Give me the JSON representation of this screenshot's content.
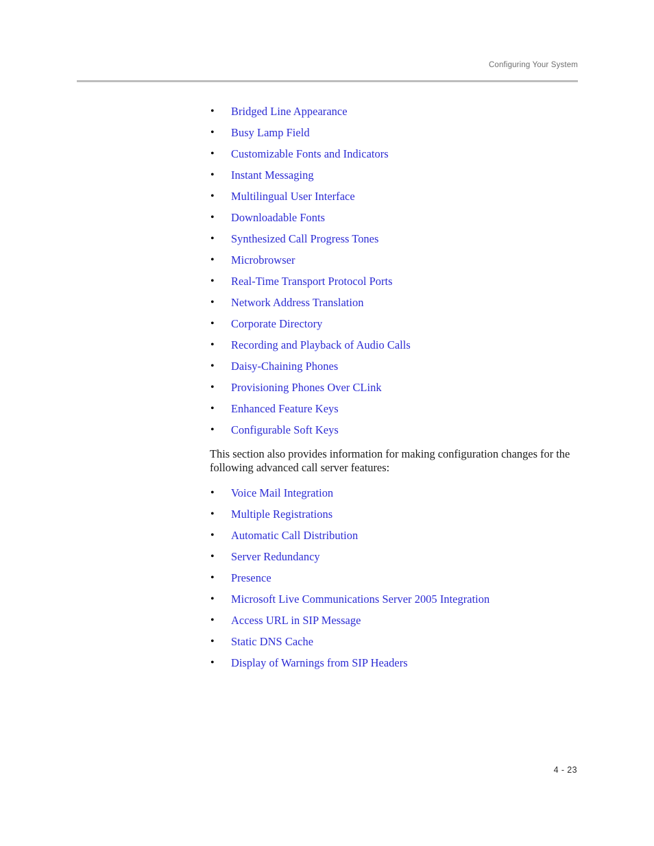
{
  "header": {
    "title": "Configuring Your System"
  },
  "colors": {
    "link": "#2b2bd4",
    "header_text": "#6e6e6e",
    "rule": "#bdbdbd",
    "body_text": "#1a1a1a",
    "page_background": "#ffffff"
  },
  "main": {
    "bullet_glyph": "•",
    "phone_feature_links": [
      {
        "label": "Bridged Line Appearance"
      },
      {
        "label": "Busy Lamp Field"
      },
      {
        "label": "Customizable Fonts and Indicators"
      },
      {
        "label": "Instant Messaging"
      },
      {
        "label": "Multilingual User Interface"
      },
      {
        "label": "Downloadable Fonts"
      },
      {
        "label": "Synthesized Call Progress Tones"
      },
      {
        "label": "Microbrowser"
      },
      {
        "label": "Real-Time Transport Protocol Ports"
      },
      {
        "label": "Network Address Translation"
      },
      {
        "label": "Corporate Directory"
      },
      {
        "label": "Recording and Playback of Audio Calls"
      },
      {
        "label": "Daisy-Chaining Phones"
      },
      {
        "label": "Provisioning Phones Over CLink"
      },
      {
        "label": "Enhanced Feature Keys"
      },
      {
        "label": "Configurable Soft Keys"
      }
    ],
    "paragraph": "This section also provides information for making configuration changes for the following advanced call server features:",
    "call_server_feature_links": [
      {
        "label": "Voice Mail Integration"
      },
      {
        "label": "Multiple Registrations"
      },
      {
        "label": "Automatic Call Distribution"
      },
      {
        "label": "Server Redundancy"
      },
      {
        "label": "Presence"
      },
      {
        "label": "Microsoft Live Communications Server 2005 Integration"
      },
      {
        "label": "Access URL in SIP Message"
      },
      {
        "label": "Static DNS Cache"
      },
      {
        "label": "Display of Warnings from SIP Headers"
      }
    ]
  },
  "footer": {
    "page_number": "4 - 23"
  }
}
